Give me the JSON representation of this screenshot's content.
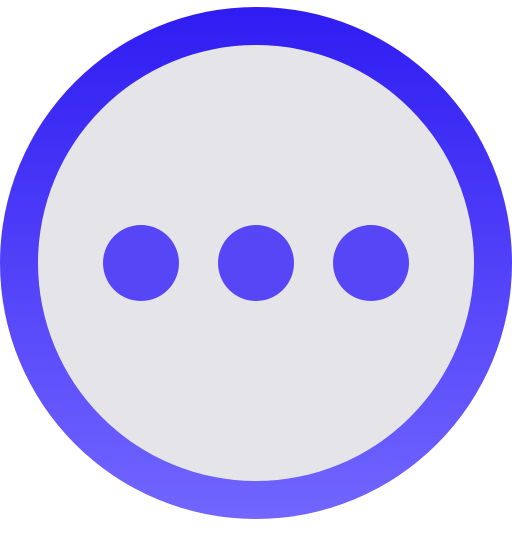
{
  "icon": {
    "name": "more-options-icon",
    "glyph": "ellipsis",
    "colors": {
      "ring_top": "#2F1CF2",
      "ring_bottom": "#7266FF",
      "face": "#E5E4E8",
      "dots": "#5746F5"
    }
  }
}
